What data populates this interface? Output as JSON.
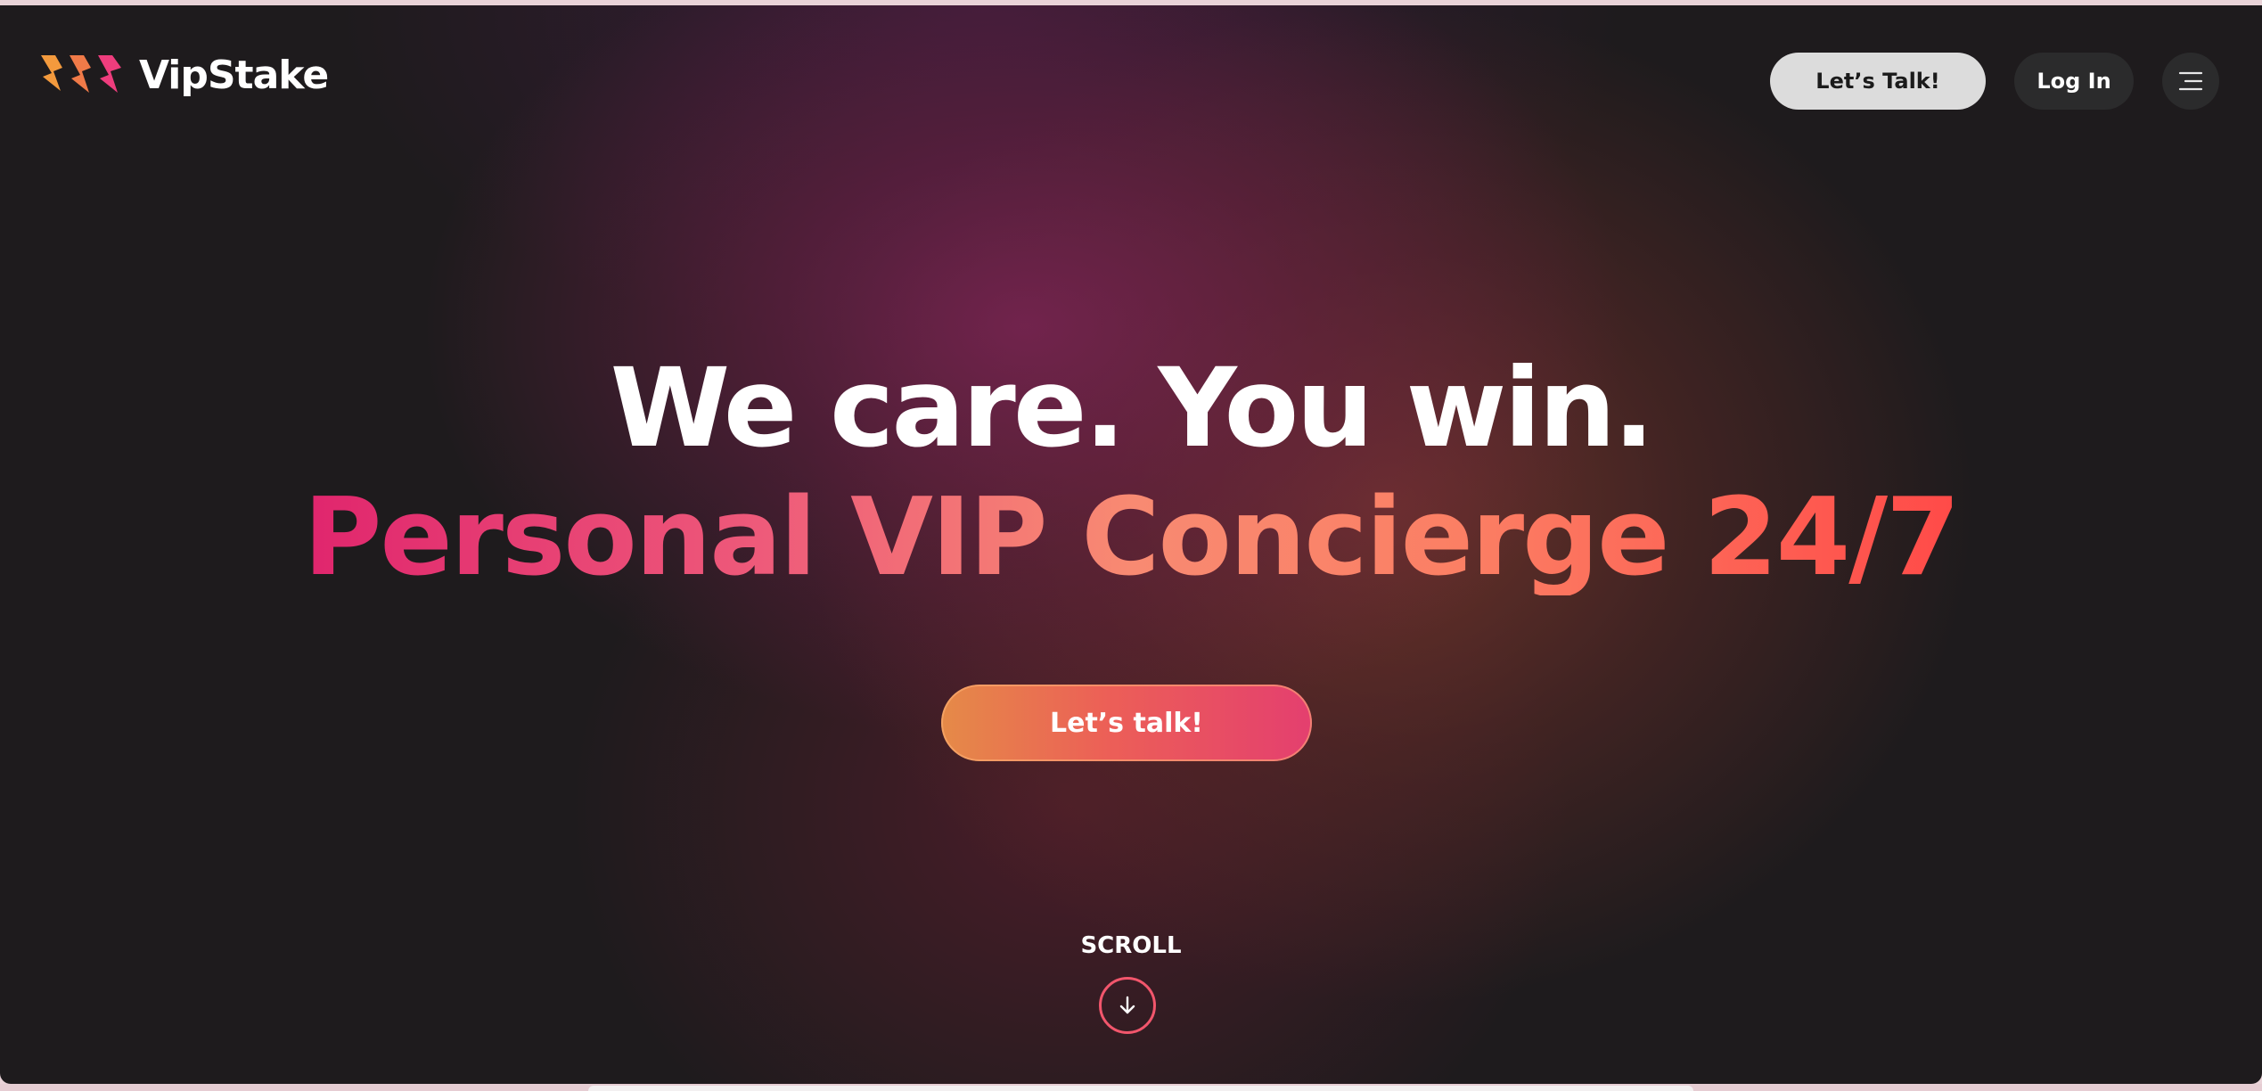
{
  "brand": {
    "name": "VipStake",
    "logo_icon": "lightning-bolts-logo",
    "colors": {
      "bolt_orange": "#f39a3d",
      "bolt_pink": "#ee3d7d",
      "accent_red": "#ff4a48",
      "accent_pink": "#e0256d"
    }
  },
  "header": {
    "talk_button_label": "Let’s Talk!",
    "login_button_label": "Log In",
    "menu_icon": "hamburger-menu-icon"
  },
  "hero": {
    "headline": "We care. You win.",
    "subheadline": "Personal VIP Concierge 24/7",
    "cta_label": "Let’s talk!"
  },
  "scroll": {
    "label": "SCROLL",
    "icon": "arrow-down-icon"
  }
}
